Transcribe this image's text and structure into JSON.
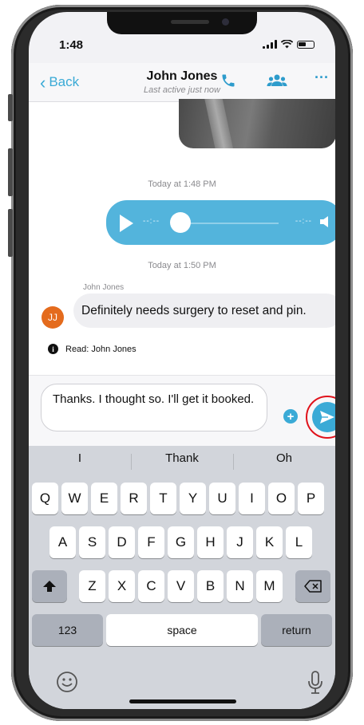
{
  "status_bar": {
    "time": "1:48"
  },
  "nav": {
    "back_label": "Back",
    "contact_name": "John Jones",
    "last_active": "Last active just now",
    "icons": [
      "phone-icon",
      "group-icon",
      "more-icon"
    ]
  },
  "chat": {
    "timestamp_1": "Today at 1:48 PM",
    "audio": {
      "elapsed": "--:--",
      "remaining": "--:--"
    },
    "timestamp_2": "Today at 1:50 PM",
    "sender_name": "John Jones",
    "avatar_initials": "JJ",
    "message_text": "Definitely needs surgery to reset and pin.",
    "read_receipt": "Read: John Jones"
  },
  "composer": {
    "draft_text": "Thanks. I thought so. I'll get it booked.",
    "plus_symbol": "+"
  },
  "keyboard": {
    "suggestions": [
      "I",
      "Thank",
      "Oh"
    ],
    "row1": [
      "Q",
      "W",
      "E",
      "R",
      "T",
      "Y",
      "U",
      "I",
      "O",
      "P"
    ],
    "row2": [
      "A",
      "S",
      "D",
      "F",
      "G",
      "H",
      "J",
      "K",
      "L"
    ],
    "row3": [
      "Z",
      "X",
      "C",
      "V",
      "B",
      "N",
      "M"
    ],
    "numbers_label": "123",
    "space_label": "space",
    "return_label": "return"
  },
  "colors": {
    "accent": "#3aaad6",
    "avatar": "#e46b1d",
    "highlight_ring": "#e0121b"
  }
}
